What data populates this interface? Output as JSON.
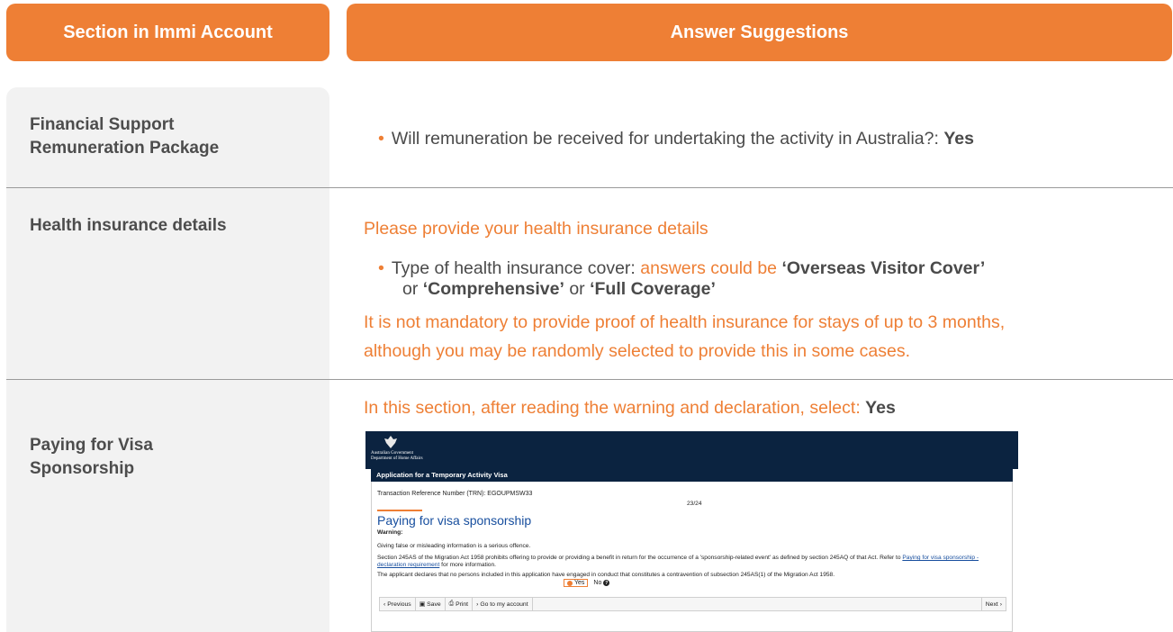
{
  "headers": {
    "left": "Section in Immi Account",
    "right": "Answer Suggestions"
  },
  "rows": {
    "financial": {
      "label_line1": "Financial Support",
      "label_line2": "Remuneration Package",
      "question": "Will remuneration be received for undertaking the activity in Australia?:",
      "answer": "Yes"
    },
    "health": {
      "label": "Health insurance details",
      "intro": "Please provide your health insurance details",
      "item_prefix": "Type of health insurance cover:",
      "item_middle": "answers could be",
      "opt1": "‘Overseas Visitor Cover’",
      "or1": "or",
      "opt2": "‘Comprehensive’",
      "or2": "or",
      "opt3": "‘Full Coverage’",
      "note_line1": "It is not mandatory to provide proof of health insurance for stays of up to 3 months,",
      "note_line2": "although you may be randomly selected to provide this in some cases."
    },
    "sponsorship": {
      "label_line1": "Paying for Visa",
      "label_line2": "Sponsorship",
      "instruction": "In this section, after reading the warning and declaration, select:",
      "answer": "Yes"
    }
  },
  "embedded_form": {
    "gov_line1": "Australian Government",
    "gov_line2": "Department of Home Affairs",
    "app_title": "Application for a Temporary Activity Visa",
    "trn": "Transaction Reference Number (TRN): EGOUPMSW33",
    "page_indicator": "23/24",
    "page_title": "Paying for visa sponsorship",
    "warning_label": "Warning:",
    "warning_text": "Giving false or misleading information is a serious offence.",
    "section_text_a": "Section 245AS of the Migration Act 1958 prohibits offering to provide or providing a benefit in return for the occurrence of a 'sponsorship-related event' as defined by section 245AQ of that Act. Refer to",
    "section_link": "Paying for visa sponsorship - declaration requirement",
    "section_text_b": "for more information.",
    "declaration": "The applicant declares that no persons included in this application have engaged in conduct that constitutes a contravention of subsection 245AS(1) of the Migration Act 1958.",
    "yes_label": "Yes",
    "no_label": "No",
    "nav": {
      "previous": "Previous",
      "save": "Save",
      "print": "Print",
      "go_account": "Go to my account",
      "next": "Next"
    }
  },
  "colors": {
    "accent": "#ee7f35",
    "navy": "#0b2340",
    "label_bg": "#f2f2f2"
  }
}
